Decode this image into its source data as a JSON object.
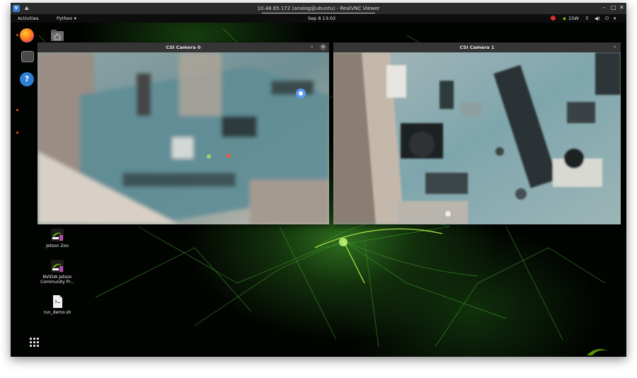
{
  "vnc": {
    "title": "10.48.65.172 (analog@ubuntu) - RealVNC Viewer",
    "logo_icon": "realvnc-icon",
    "controls": [
      "–",
      "□",
      "✕"
    ]
  },
  "top_bar": {
    "activities": "Activities",
    "app_menu": "Python ▾",
    "datetime": "Sep 8  13:02",
    "power_watts": "15W",
    "status_icons": [
      "network-icon",
      "volume-icon",
      "power-icon"
    ]
  },
  "dock": {
    "items": [
      {
        "name": "firefox",
        "icon": "firefox-icon"
      },
      {
        "name": "files",
        "icon": "files-icon"
      },
      {
        "name": "help",
        "icon": "help-icon",
        "glyph": "?"
      }
    ]
  },
  "windows": [
    {
      "title": "CSI Camera 0",
      "buttons": [
        "–",
        "✕"
      ]
    },
    {
      "title": "CSI Camera 1",
      "buttons": [
        "–"
      ]
    }
  ],
  "desktop_icons": [
    {
      "label": "Home",
      "icon": "home-folder-icon"
    },
    {
      "label": "Jetson Zoo",
      "icon": "nvidia-icon"
    },
    {
      "label": "NVIDIA Jetson Community Pr...",
      "icon": "nvidia-icon"
    },
    {
      "label": "run_demo.sh",
      "icon": "script-file-icon"
    }
  ],
  "colors": {
    "nvidia_green": "#76b900",
    "desktop_bg": "#020402",
    "titlebar": "#353535"
  }
}
